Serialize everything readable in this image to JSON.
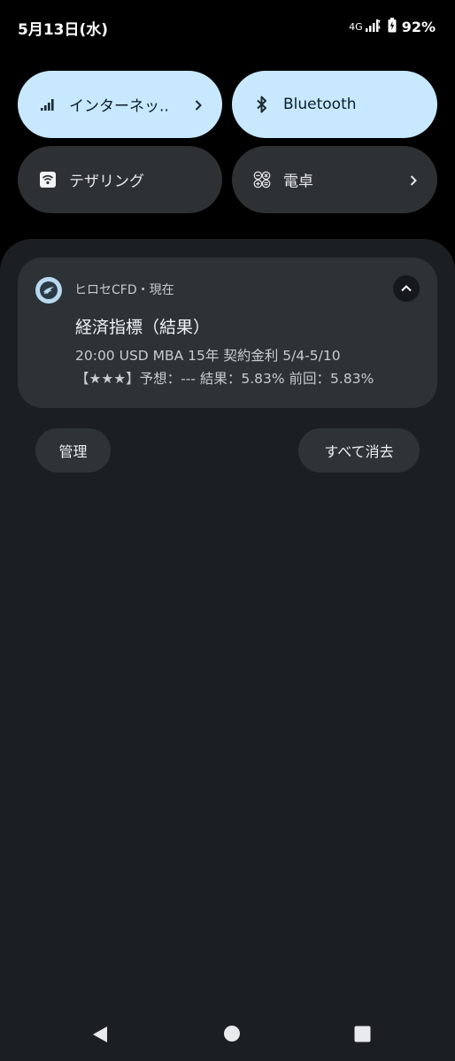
{
  "status_bar": {
    "date": "5月13日(水)",
    "network": "4G",
    "battery": "92%"
  },
  "quick_tiles": [
    {
      "label": "インターネッ..",
      "icon": "signal-icon",
      "state": "active",
      "has_chevron": true
    },
    {
      "label": "Bluetooth",
      "icon": "bluetooth-icon",
      "state": "active",
      "has_chevron": false
    },
    {
      "label": "テザリング",
      "icon": "hotspot-icon",
      "state": "inactive",
      "has_chevron": false
    },
    {
      "label": "電卓",
      "icon": "calculator-icon",
      "state": "inactive",
      "has_chevron": true
    }
  ],
  "notification": {
    "app_line": "ヒロセCFD・現在",
    "title": "経済指標（結果）",
    "body_line1": "20:00 USD MBA 15年 契約金利 5/4-5/10",
    "body_line2": "【★★★】予想：--- 結果：5.83% 前回：5.83%"
  },
  "actions": {
    "manage": "管理",
    "clear_all": "すべて消去"
  },
  "colors": {
    "tile_active": "#c7e8fe",
    "tile_inactive": "#2d3133",
    "shade": "#1b1f22",
    "card": "#2d3236"
  }
}
